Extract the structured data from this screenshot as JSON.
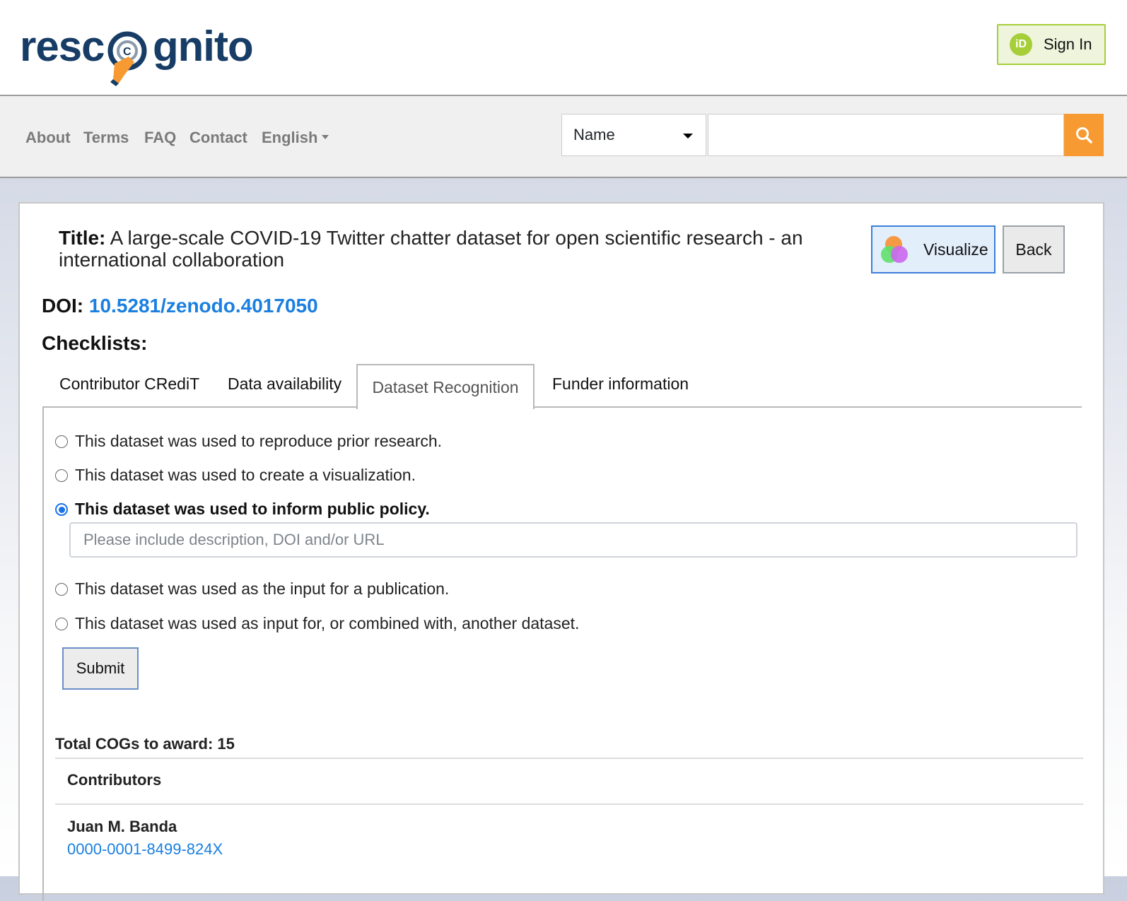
{
  "header": {
    "logo_part1": "resc",
    "logo_part2": "gnito",
    "sign_in_label": "Sign In",
    "orcid_badge": "iD"
  },
  "nav": {
    "links": [
      "About",
      "Terms",
      "FAQ",
      "Contact"
    ],
    "language": "English",
    "search_type": "Name",
    "search_value": ""
  },
  "record": {
    "title_label": "Title:",
    "title": "A large-scale COVID-19 Twitter chatter dataset for open scientific research - an international collaboration",
    "visualize_label": "Visualize",
    "back_label": "Back",
    "doi_label": "DOI:",
    "doi": "10.5281/zenodo.4017050",
    "checklists_label": "Checklists:"
  },
  "tabs": [
    "Contributor CRediT",
    "Data availability",
    "Dataset Recognition",
    "Funder information"
  ],
  "active_tab": "Dataset Recognition",
  "options": [
    "This dataset was used to reproduce prior research.",
    "This dataset was used to create a visualization.",
    "This dataset was used to inform public policy.",
    "This dataset was used as the input for a publication.",
    "This dataset was used as input for, or combined with, another dataset."
  ],
  "selected_option": "This dataset was used to inform public policy.",
  "description_placeholder": "Please include description, DOI and/or URL",
  "submit_label": "Submit",
  "total_cogs": "Total COGs to award: 15",
  "contributors_heading": "Contributors",
  "contributors": [
    {
      "name": "Juan M. Banda",
      "orcid": "0000-0001-8499-824X"
    }
  ],
  "colors": {
    "brand_navy": "#173d66",
    "brand_orange": "#f79a32",
    "orcid_green": "#a6ce39",
    "link_blue": "#1a7fe0"
  }
}
